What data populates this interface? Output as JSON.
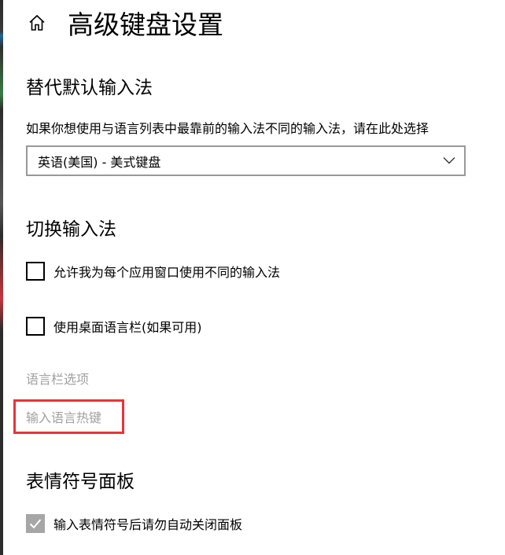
{
  "header": {
    "home_icon": "home-icon",
    "title": "高级键盘设置"
  },
  "override_input": {
    "section_title": "替代默认输入法",
    "description": "如果你想使用与语言列表中最靠前的输入法不同的输入法，请在此处选择",
    "dropdown_value": "英语(美国) - 美式键盘",
    "dropdown_icon": "chevron-down-icon"
  },
  "switch_input": {
    "section_title": "切换输入法",
    "options": [
      {
        "label": "允许我为每个应用窗口使用不同的输入法",
        "checked": false
      },
      {
        "label": "使用桌面语言栏(如果可用)",
        "checked": false
      }
    ],
    "language_bar_options_link": "语言栏选项",
    "input_language_hotkeys_link": "输入语言热键"
  },
  "emoji_panel": {
    "section_title": "表情符号面板",
    "option": {
      "label": "输入表情符号后请勿自动关闭面板",
      "checked": true,
      "disabled": true
    }
  },
  "colors": {
    "highlight": "#e8333a",
    "disabled_text": "#a0a0a0",
    "border": "#999999"
  }
}
